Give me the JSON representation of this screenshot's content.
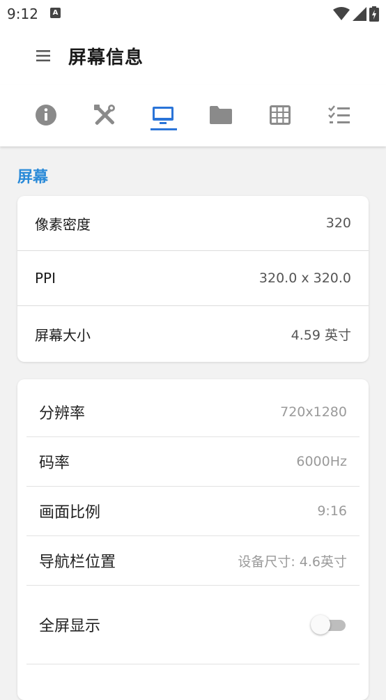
{
  "status": {
    "time": "9:12",
    "notification_glyph": "A"
  },
  "appbar": {
    "title": "屏幕信息"
  },
  "tabs": [
    {
      "id": "info",
      "icon": "info-icon"
    },
    {
      "id": "tools",
      "icon": "tools-icon"
    },
    {
      "id": "display",
      "icon": "monitor-icon",
      "selected": true
    },
    {
      "id": "storage",
      "icon": "folder-icon"
    },
    {
      "id": "grid",
      "icon": "grid-icon"
    },
    {
      "id": "checklist",
      "icon": "checklist-icon"
    }
  ],
  "colors": {
    "accent": "#2a74d8",
    "section": "#2a8ad8",
    "icon_gray": "#8a8a8a"
  },
  "section": {
    "title": "屏幕"
  },
  "card1": {
    "rows": [
      {
        "label": "像素密度",
        "value": "320"
      },
      {
        "label": "PPI",
        "value": "320.0 x 320.0"
      },
      {
        "label": "屏幕大小",
        "value": "4.59 英寸"
      }
    ]
  },
  "card2": {
    "rows": [
      {
        "label": "分辨率",
        "value": "720x1280"
      },
      {
        "label": "码率",
        "value": "6000Hz"
      },
      {
        "label": "画面比例",
        "value": "9:16"
      },
      {
        "label": "导航栏位置",
        "value": "设备尺寸: 4.6英寸"
      }
    ],
    "toggle_row": {
      "label": "全屏显示",
      "on": false
    }
  }
}
